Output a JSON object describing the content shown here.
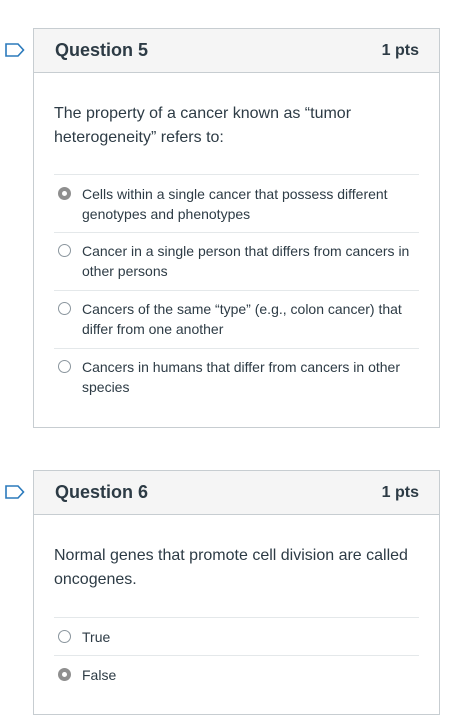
{
  "questions": [
    {
      "title": "Question 5",
      "points": "1 pts",
      "text": "The property of a cancer known as “tumor heterogeneity” refers to:",
      "answers": [
        {
          "label": "Cells within a single cancer that possess different genotypes and phenotypes",
          "selected": true
        },
        {
          "label": "Cancer in a single person that differs from cancers in other persons",
          "selected": false
        },
        {
          "label": "Cancers of the same “type” (e.g., colon cancer) that differ from one another",
          "selected": false
        },
        {
          "label": "Cancers in humans that differ from cancers in other species",
          "selected": false
        }
      ]
    },
    {
      "title": "Question 6",
      "points": "1 pts",
      "text": "Normal genes that promote cell division are called oncogenes.",
      "answers": [
        {
          "label": "True",
          "selected": false
        },
        {
          "label": "False",
          "selected": true
        }
      ]
    }
  ],
  "colors": {
    "flag": "#2b7abc",
    "text": "#2d3b45",
    "header_bg": "#f5f5f5",
    "border": "#c7cdd1",
    "selected_radio": "#8f8f8f"
  },
  "icons": {
    "flag": "flag-outline-icon"
  }
}
